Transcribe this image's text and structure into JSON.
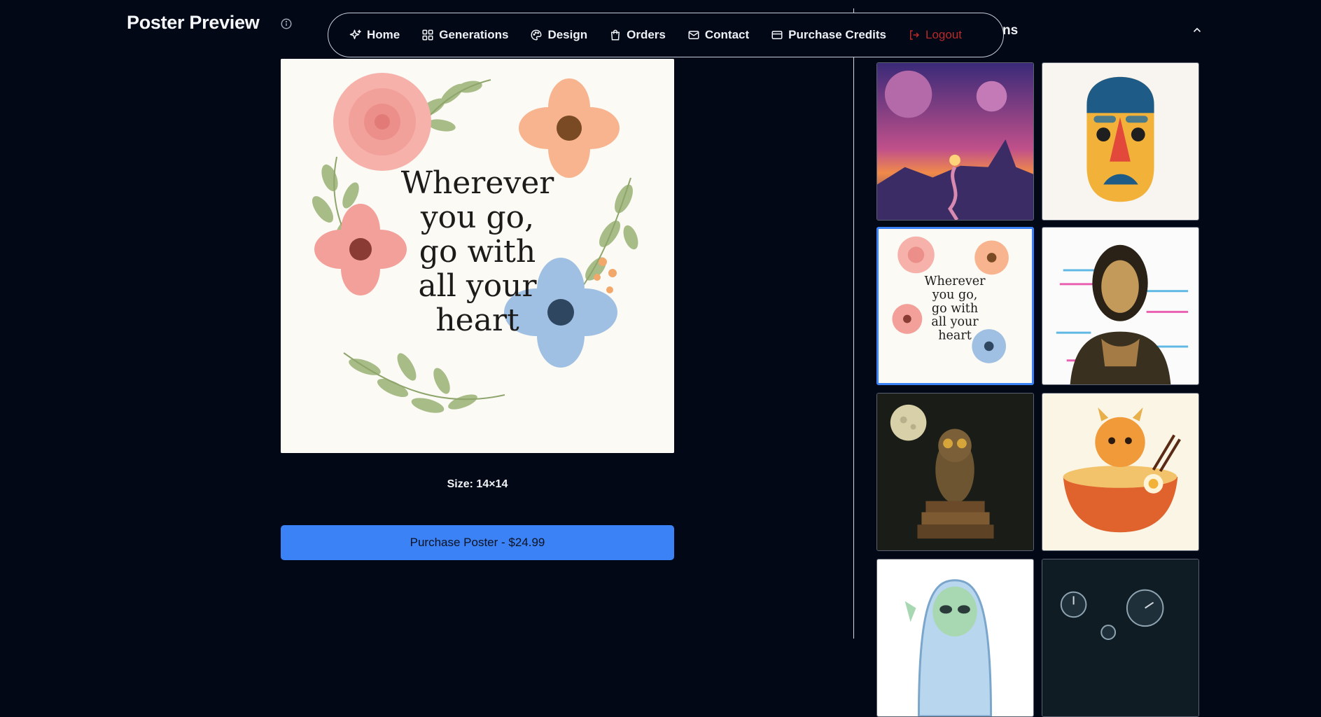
{
  "page": {
    "title": "Poster Preview"
  },
  "nav": {
    "items": [
      {
        "label": "Home",
        "icon": "sparkle-icon"
      },
      {
        "label": "Generations",
        "icon": "grid-icon"
      },
      {
        "label": "Design",
        "icon": "palette-icon"
      },
      {
        "label": "Orders",
        "icon": "shopping-bag-icon"
      },
      {
        "label": "Contact",
        "icon": "mail-icon"
      },
      {
        "label": "Purchase Credits",
        "icon": "credit-card-icon"
      },
      {
        "label": "Logout",
        "icon": "logout-icon"
      }
    ],
    "logout_color": "#b82a2a"
  },
  "poster": {
    "quote_lines": [
      "Wherever",
      "you go,",
      "go with",
      "all your",
      "heart"
    ],
    "size_text": "Size: 14×14",
    "purchase_label": "Purchase Poster - $24.99"
  },
  "sidebar": {
    "title": "ns",
    "thumbnails": [
      {
        "subject": "purple planets sunset landscape",
        "selected": false
      },
      {
        "subject": "yellow mask face",
        "selected": false
      },
      {
        "subject": "floral quote poster",
        "selected": true,
        "quote_lines": [
          "Wherever",
          "you go,",
          "go with",
          "all your",
          "heart"
        ]
      },
      {
        "subject": "glitch mona lisa",
        "selected": false
      },
      {
        "subject": "owl on books under moon",
        "selected": false
      },
      {
        "subject": "dragon in ramen bowl",
        "selected": false
      },
      {
        "subject": "waving alien",
        "selected": false
      },
      {
        "subject": "floating clocks",
        "selected": false
      }
    ]
  },
  "colors": {
    "background": "#030816",
    "accent": "#3b82f6",
    "text": "#ffffff"
  }
}
